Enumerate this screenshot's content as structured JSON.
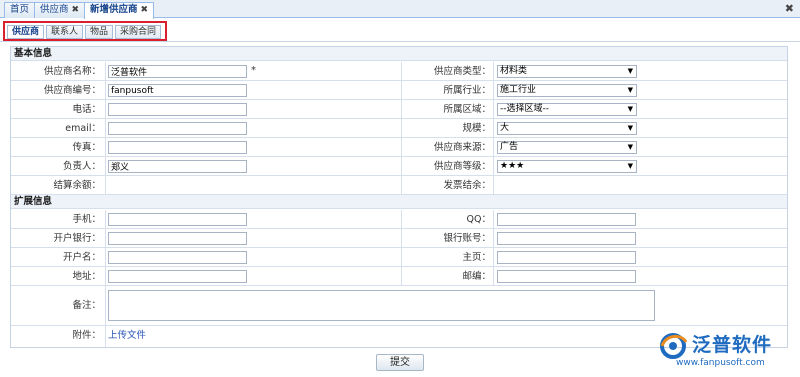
{
  "top_tabs": [
    {
      "label": "首页"
    },
    {
      "label": "供应商"
    },
    {
      "label": "新增供应商"
    }
  ],
  "sub_tabs": [
    {
      "label": "供应商"
    },
    {
      "label": "联系人"
    },
    {
      "label": "物品"
    },
    {
      "label": "采购合同"
    }
  ],
  "sections": {
    "basic": "基本信息",
    "extended": "扩展信息"
  },
  "basic_left": [
    {
      "label": "供应商名称：",
      "value": "泛普软件",
      "required": "*"
    },
    {
      "label": "供应商编号：",
      "value": "fanpusoft"
    },
    {
      "label": "电话：",
      "value": ""
    },
    {
      "label": "email：",
      "value": ""
    },
    {
      "label": "传真：",
      "value": ""
    },
    {
      "label": "负责人：",
      "value": "郑义"
    },
    {
      "label": "结算余额："
    }
  ],
  "basic_right": [
    {
      "label": "供应商类型：",
      "value": "材料类"
    },
    {
      "label": "所属行业：",
      "value": "施工行业"
    },
    {
      "label": "所属区域：",
      "value": "--选择区域--"
    },
    {
      "label": "规模：",
      "value": "大"
    },
    {
      "label": "供应商来源：",
      "value": "广告"
    },
    {
      "label": "供应商等级：",
      "value": "★★★"
    },
    {
      "label": "发票结余："
    }
  ],
  "ext_left": [
    {
      "label": "手机：",
      "value": ""
    },
    {
      "label": "开户银行：",
      "value": ""
    },
    {
      "label": "开户名：",
      "value": ""
    },
    {
      "label": "地址：",
      "value": ""
    }
  ],
  "ext_right": [
    {
      "label": "QQ：",
      "value": ""
    },
    {
      "label": "银行账号：",
      "value": ""
    },
    {
      "label": "主页：",
      "value": ""
    },
    {
      "label": "邮编：",
      "value": ""
    }
  ],
  "remark": {
    "label": "备注：",
    "value": ""
  },
  "attachment": {
    "label": "附件：",
    "link": "上传文件"
  },
  "submit_label": "提交",
  "logo": {
    "text": "泛普软件",
    "url": "www.fanpusoft.com"
  },
  "colors": {
    "accent": "#15428b",
    "highlight_border": "#d9202f",
    "logo": "#1f6bc0"
  }
}
